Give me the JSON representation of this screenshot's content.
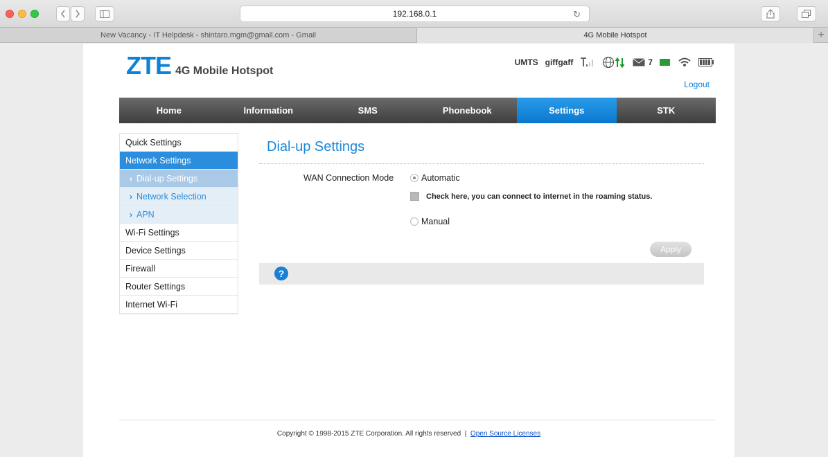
{
  "browser": {
    "url": "192.168.0.1",
    "tabs": [
      {
        "title": "New Vacancy - IT Helpdesk - shintaro.mgm@gmail.com - Gmail"
      },
      {
        "title": "4G Mobile Hotspot"
      }
    ],
    "reload_icon": "reload-icon",
    "share_icon": "share-icon",
    "tabs_icon": "show-tabs-icon"
  },
  "header": {
    "logo_text": "ZTE",
    "product_title": "4G Mobile Hotspot",
    "network_type": "UMTS",
    "carrier": "giffgaff",
    "sms_count": "7",
    "logout": "Logout"
  },
  "menu": [
    {
      "label": "Home"
    },
    {
      "label": "Information"
    },
    {
      "label": "SMS"
    },
    {
      "label": "Phonebook"
    },
    {
      "label": "Settings"
    },
    {
      "label": "STK"
    }
  ],
  "sidebar": {
    "items": [
      {
        "label": "Quick Settings"
      },
      {
        "label": "Network Settings"
      },
      {
        "label": "Dial-up Settings"
      },
      {
        "label": "Network Selection"
      },
      {
        "label": "APN"
      },
      {
        "label": "Wi-Fi Settings"
      },
      {
        "label": "Device Settings"
      },
      {
        "label": "Firewall"
      },
      {
        "label": "Router Settings"
      },
      {
        "label": "Internet Wi-Fi"
      }
    ]
  },
  "main": {
    "title": "Dial-up Settings",
    "wan_label": "WAN Connection Mode",
    "option_automatic": "Automatic",
    "roaming_text": "Check here, you can connect to internet in the roaming status.",
    "option_manual": "Manual",
    "apply": "Apply",
    "help_symbol": "?"
  },
  "footer": {
    "copyright": "Copyright © 1998-2015 ZTE Corporation. All rights reserved",
    "separator": "|",
    "licenses_link": "Open Source Licenses"
  },
  "colors": {
    "brand_blue": "#0a83d8",
    "menu_active": "#1a8ce0",
    "sidebar_active": "#2a8ddd"
  }
}
